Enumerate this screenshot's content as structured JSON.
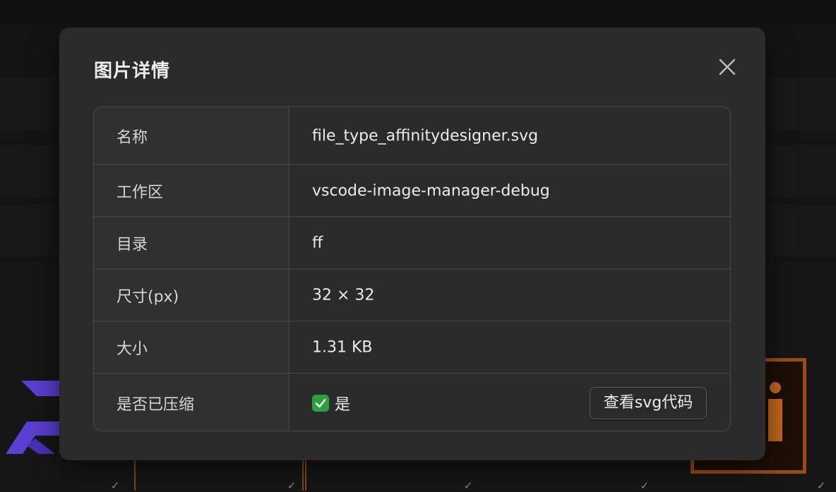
{
  "modal": {
    "title": "图片详情",
    "close_icon": "close-icon"
  },
  "details": {
    "rows": [
      {
        "label": "名称",
        "value": "file_type_affinitydesigner.svg"
      },
      {
        "label": "工作区",
        "value": "vscode-image-manager-debug"
      },
      {
        "label": "目录",
        "value": "ff"
      },
      {
        "label": "尺寸(px)",
        "value": "32 × 32"
      },
      {
        "label": "大小",
        "value": "1.31 KB"
      },
      {
        "label": "是否已压缩",
        "value": "是"
      }
    ],
    "name_action_icon": "scan-locate-icon",
    "compressed_icon": "check-mark-emoji-icon",
    "view_svg_button_label": "查看svg代码"
  },
  "colors": {
    "modal_bg": "#2b2b2b",
    "label_cell_bg": "#303030",
    "border": "#4a4a4a",
    "highlight_box": "#e3001b",
    "check_green": "#2e9e3e"
  }
}
